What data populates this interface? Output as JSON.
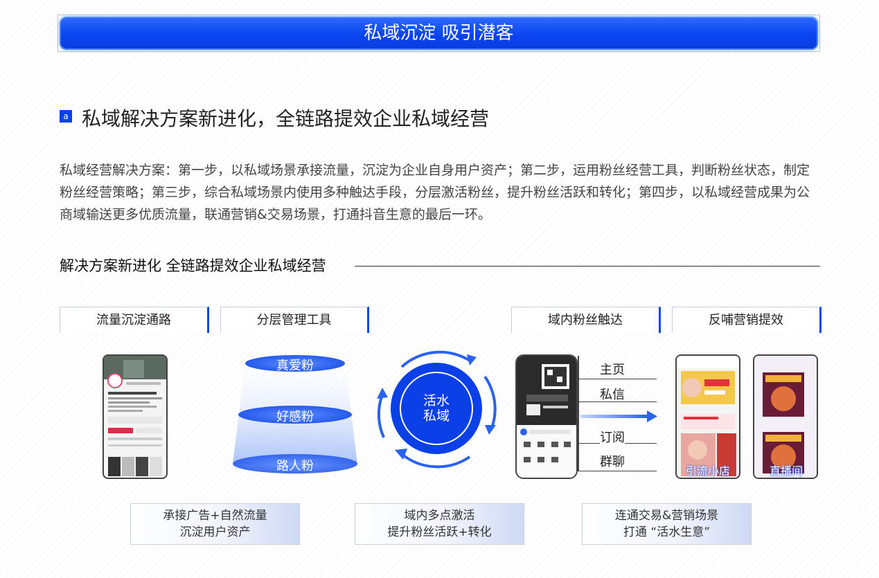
{
  "banner": {
    "title": "私域沉淀 吸引潜客"
  },
  "section": {
    "marker": "a",
    "title": "私域解决方案新进化，全链路提效企业私域经营",
    "paragraph": "私域经营解决方案：第一步，以私域场景承接流量，沉淀为企业自身用户资产；第二步，运用粉丝经营工具，判断粉丝状态，制定粉丝经营策略；第三步，综合私域场景内使用多种触达手段，分层激活粉丝，提升粉丝活跃和转化；第四步，以私域经营成果为公商域输送更多优质流量，联通营销&交易场景，打通抖音生意的最后一环。"
  },
  "diagram": {
    "title": "解决方案新进化 全链路提效企业私域经营",
    "tabs": [
      "流量沉淀通路",
      "分层管理工具",
      "域内粉丝触达",
      "反哺营销提效"
    ],
    "funnel": [
      "真爱粉",
      "好感粉",
      "路人粉"
    ],
    "center": [
      "活水",
      "私域"
    ],
    "reach_list": [
      "主页",
      "私信",
      "订阅",
      "群聊"
    ],
    "phone_tags": [
      "引流小店",
      "直播间"
    ],
    "bottom_boxes": [
      [
        "承接广告+自然流量",
        "沉淀用户资产"
      ],
      [
        "域内多点激活",
        "提升粉丝活跃+转化"
      ],
      [
        "连通交易&营销场景",
        "打通 “活水生意”"
      ]
    ]
  },
  "colors": {
    "primary": "#0b40e8",
    "banner": "#1a55f5",
    "funnel": "#3e72f0"
  }
}
